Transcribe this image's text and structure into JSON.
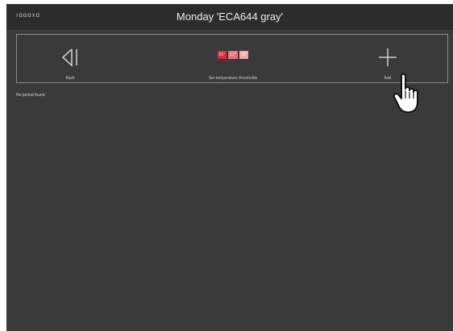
{
  "header": {
    "logo_text": "ıɑɑɑxɑ",
    "title": "Monday 'ECA644 gray'"
  },
  "toolbar": {
    "back_label": "Back",
    "thresholds_label": "Set temperature thresholds",
    "add_label": "Add",
    "thresholds": [
      {
        "value": "21°",
        "color": "#e0283a"
      },
      {
        "value": "17°",
        "color": "#ec6f7a"
      },
      {
        "value": "13°",
        "color": "#f3a7ad"
      }
    ]
  },
  "main": {
    "status": "No period found"
  },
  "colors": {
    "background": "#3a3a3a",
    "titlebar": "#2c2c2c",
    "border": "#8a8a8a"
  }
}
